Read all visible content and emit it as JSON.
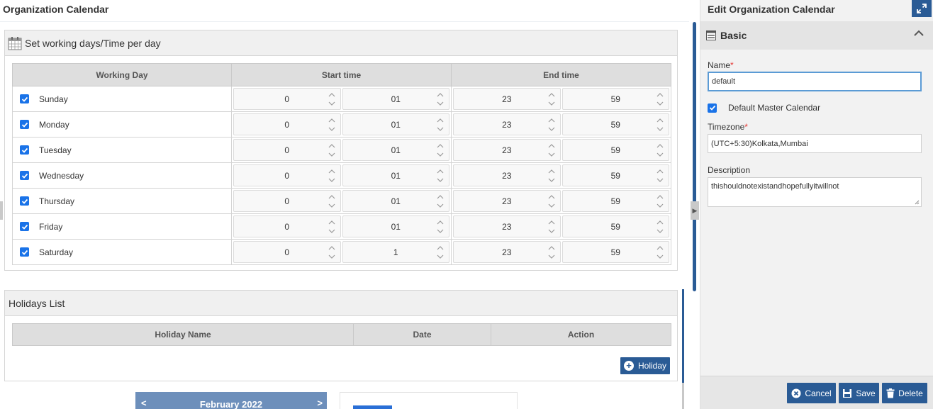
{
  "main": {
    "title": "Organization Calendar"
  },
  "working_days": {
    "title": "Set working days/Time per day",
    "headers": {
      "day": "Working Day",
      "start": "Start time",
      "end": "End time"
    },
    "rows": [
      {
        "day": "Sunday",
        "checked": true,
        "start_h": "0",
        "start_m": "01",
        "end_h": "23",
        "end_m": "59"
      },
      {
        "day": "Monday",
        "checked": true,
        "start_h": "0",
        "start_m": "01",
        "end_h": "23",
        "end_m": "59"
      },
      {
        "day": "Tuesday",
        "checked": true,
        "start_h": "0",
        "start_m": "01",
        "end_h": "23",
        "end_m": "59"
      },
      {
        "day": "Wednesday",
        "checked": true,
        "start_h": "0",
        "start_m": "01",
        "end_h": "23",
        "end_m": "59"
      },
      {
        "day": "Thursday",
        "checked": true,
        "start_h": "0",
        "start_m": "01",
        "end_h": "23",
        "end_m": "59"
      },
      {
        "day": "Friday",
        "checked": true,
        "start_h": "0",
        "start_m": "01",
        "end_h": "23",
        "end_m": "59"
      },
      {
        "day": "Saturday",
        "checked": true,
        "start_h": "0",
        "start_m": "1",
        "end_h": "23",
        "end_m": "59"
      }
    ]
  },
  "holidays": {
    "title": "Holidays List",
    "headers": {
      "name": "Holiday Name",
      "date": "Date",
      "action": "Action"
    },
    "add_label": "Holiday"
  },
  "mini_calendar": {
    "prev": "<",
    "month": "February 2022",
    "next": ">"
  },
  "side": {
    "title": "Edit Organization Calendar",
    "section": "Basic",
    "name_label": "Name",
    "name_value": "default",
    "default_master_label": "Default Master Calendar",
    "default_master_checked": true,
    "timezone_label": "Timezone",
    "timezone_value": "(UTC+5:30)Kolkata,Mumbai",
    "description_label": "Description",
    "description_value": "thishouldnotexistandhopefullyitwillnot",
    "required_mark": "*"
  },
  "footer": {
    "cancel": "Cancel",
    "save": "Save",
    "delete": "Delete"
  },
  "colors": {
    "primary": "#2a5b95",
    "checkbox": "#1a73e8",
    "required": "#e53935"
  }
}
